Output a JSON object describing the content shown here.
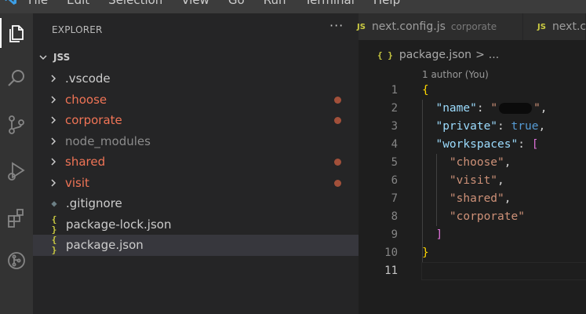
{
  "menubar": {
    "items": [
      "File",
      "Edit",
      "Selection",
      "View",
      "Go",
      "Run",
      "Terminal",
      "Help"
    ]
  },
  "activity_bar": {
    "icons": [
      "explorer-icon",
      "search-icon",
      "source-control-icon",
      "run-debug-icon",
      "extensions-icon",
      "remote-icon"
    ]
  },
  "sidebar": {
    "header": "EXPLORER",
    "more": "···",
    "root": "JSS",
    "items": [
      {
        "label": ".vscode",
        "type": "folder",
        "status": "default",
        "modified": false
      },
      {
        "label": "choose",
        "type": "folder",
        "status": "modified",
        "modified": true
      },
      {
        "label": "corporate",
        "type": "folder",
        "status": "modified",
        "modified": true
      },
      {
        "label": "node_modules",
        "type": "folder",
        "status": "ignored",
        "modified": false
      },
      {
        "label": "shared",
        "type": "folder",
        "status": "modified",
        "modified": true
      },
      {
        "label": "visit",
        "type": "folder",
        "status": "modified",
        "modified": true
      },
      {
        "label": ".gitignore",
        "type": "file-git",
        "status": "default",
        "modified": false
      },
      {
        "label": "package-lock.json",
        "type": "file-json",
        "status": "default",
        "modified": false
      },
      {
        "label": "package.json",
        "type": "file-json",
        "status": "default",
        "modified": false,
        "selected": true
      }
    ]
  },
  "editor": {
    "tabs": [
      {
        "icon": "JS",
        "name": "next.config.js",
        "description": "corporate"
      },
      {
        "icon": "JS",
        "name": "next.c"
      }
    ],
    "breadcrumb": {
      "icon": "{ }",
      "file": "package.json",
      "separator": ">",
      "more": "..."
    },
    "codelens": "1 author (You)",
    "lines": [
      {
        "n": "1",
        "tokens": [
          {
            "t": "{",
            "c": "brace"
          }
        ]
      },
      {
        "n": "2",
        "tokens": [
          {
            "t": "  ",
            "c": "punc"
          },
          {
            "t": "\"name\"",
            "c": "key"
          },
          {
            "t": ": ",
            "c": "punc"
          },
          {
            "t": "\"",
            "c": "str"
          },
          {
            "t": "",
            "c": "redact"
          },
          {
            "t": "\"",
            "c": "str"
          },
          {
            "t": ",",
            "c": "punc"
          }
        ]
      },
      {
        "n": "3",
        "tokens": [
          {
            "t": "  ",
            "c": "punc"
          },
          {
            "t": "\"private\"",
            "c": "key"
          },
          {
            "t": ": ",
            "c": "punc"
          },
          {
            "t": "true",
            "c": "bool"
          },
          {
            "t": ",",
            "c": "punc"
          }
        ]
      },
      {
        "n": "4",
        "tokens": [
          {
            "t": "  ",
            "c": "punc"
          },
          {
            "t": "\"workspaces\"",
            "c": "key"
          },
          {
            "t": ": ",
            "c": "punc"
          },
          {
            "t": "[",
            "c": "bracket"
          }
        ]
      },
      {
        "n": "5",
        "tokens": [
          {
            "t": "    ",
            "c": "punc"
          },
          {
            "t": "\"choose\"",
            "c": "str"
          },
          {
            "t": ",",
            "c": "punc"
          }
        ]
      },
      {
        "n": "6",
        "tokens": [
          {
            "t": "    ",
            "c": "punc"
          },
          {
            "t": "\"visit\"",
            "c": "str"
          },
          {
            "t": ",",
            "c": "punc"
          }
        ]
      },
      {
        "n": "7",
        "tokens": [
          {
            "t": "    ",
            "c": "punc"
          },
          {
            "t": "\"shared\"",
            "c": "str"
          },
          {
            "t": ",",
            "c": "punc"
          }
        ]
      },
      {
        "n": "8",
        "tokens": [
          {
            "t": "    ",
            "c": "punc"
          },
          {
            "t": "\"corporate\"",
            "c": "str"
          }
        ]
      },
      {
        "n": "9",
        "tokens": [
          {
            "t": "  ",
            "c": "punc"
          },
          {
            "t": "]",
            "c": "bracket"
          }
        ]
      },
      {
        "n": "10",
        "tokens": [
          {
            "t": "}",
            "c": "brace"
          }
        ]
      },
      {
        "n": "11",
        "tokens": [],
        "current": true
      }
    ]
  },
  "colors": {
    "modified": "#f07456",
    "ignored": "#8c8c8c",
    "modified_dot": "#a2503a",
    "json_icon": "#cbcb41"
  }
}
